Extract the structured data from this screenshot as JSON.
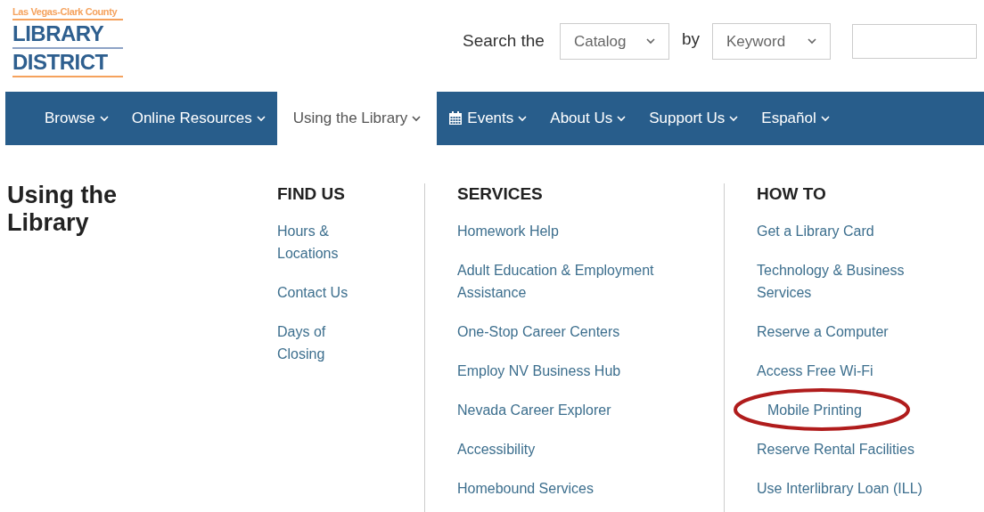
{
  "logo": {
    "tagline": "Las Vegas-Clark County",
    "line_1": "LIBRARY",
    "line_2": "DISTRICT"
  },
  "search": {
    "label": "Search the",
    "scope": "Catalog",
    "connector": "by",
    "field_type": "Keyword"
  },
  "nav": [
    {
      "label": "Browse",
      "selected": false
    },
    {
      "label": "Online Resources",
      "selected": false
    },
    {
      "label": "Using the Library",
      "selected": true
    },
    {
      "label": "Events",
      "selected": false,
      "kind": "calendar"
    },
    {
      "label": "About Us",
      "selected": false
    },
    {
      "label": "Support Us",
      "selected": false
    },
    {
      "label": "Español",
      "selected": false
    }
  ],
  "menu": {
    "title": "Using the Library",
    "columns": [
      {
        "heading": "FIND US",
        "links": [
          {
            "label": "Hours & Locations",
            "circled": false
          },
          {
            "label": "Contact Us",
            "circled": false
          },
          {
            "label": "Days of Closing",
            "circled": false
          }
        ]
      },
      {
        "heading": "SERVICES",
        "links": [
          {
            "label": "Homework Help",
            "circled": false
          },
          {
            "label": "Adult Education & Employment Assistance",
            "circled": false
          },
          {
            "label": "One-Stop Career Centers",
            "circled": false
          },
          {
            "label": "Employ NV Business Hub",
            "circled": false
          },
          {
            "label": "Nevada Career Explorer",
            "circled": false
          },
          {
            "label": "Accessibility",
            "circled": false
          },
          {
            "label": "Homebound Services",
            "circled": false
          }
        ]
      },
      {
        "heading": "HOW TO",
        "links": [
          {
            "label": "Get a Library Card",
            "circled": false
          },
          {
            "label": "Technology & Business Services",
            "circled": false
          },
          {
            "label": "Reserve a Computer",
            "circled": false
          },
          {
            "label": "Access Free Wi-Fi",
            "circled": false
          },
          {
            "label": "Mobile Printing",
            "circled": true
          },
          {
            "label": "Reserve Rental Facilities",
            "circled": false
          },
          {
            "label": "Use Interlibrary Loan (ILL)",
            "circled": false
          }
        ]
      }
    ]
  }
}
